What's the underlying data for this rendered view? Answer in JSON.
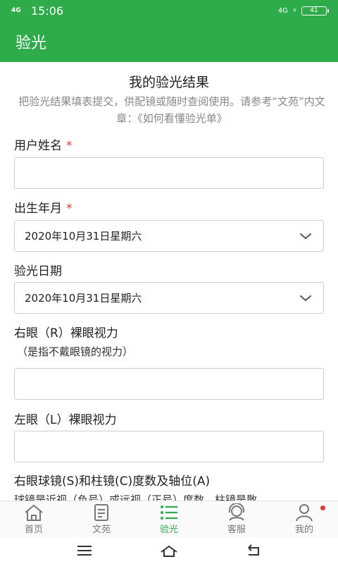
{
  "status_bar": {
    "network": "4G",
    "time": "15:06",
    "network_right": "4G",
    "battery": "41"
  },
  "app_bar": {
    "title": "验光"
  },
  "form": {
    "title": "我的验光结果",
    "description": "把验光结果填表提交，供配镜或随时查阅使用。请参考“文苑”内文章：《如何看懂验光单》",
    "required_mark": "*",
    "name_label": "用户姓名",
    "name_value": "",
    "birth_label": "出生年月",
    "birth_value": "2020年10月31日星期六",
    "exam_label": "验光日期",
    "exam_value": "2020年10月31日星期六",
    "right_eye_label": "右眼（R）裸眼视力",
    "right_eye_note": "（是指不戴眼镜的视力）",
    "right_eye_value": "",
    "left_eye_label": "左眼（L）裸眼视力",
    "left_eye_value": "",
    "right_lens_label": "右眼球镜(S)和柱镜(C)度数及轴位(A)",
    "right_lens_note": "球镜是近视（负号）或远视（正号）度数，柱镜是散"
  },
  "bottom_nav": {
    "items": [
      {
        "label": "首页",
        "icon": "home-icon"
      },
      {
        "label": "文苑",
        "icon": "article-icon"
      },
      {
        "label": "验光",
        "icon": "list-icon"
      },
      {
        "label": "客服",
        "icon": "support-icon"
      },
      {
        "label": "我的",
        "icon": "person-icon"
      }
    ],
    "active": "验光"
  },
  "colors": {
    "primary": "#2eab4a",
    "required": "#e53935",
    "muted_text": "#888888"
  }
}
